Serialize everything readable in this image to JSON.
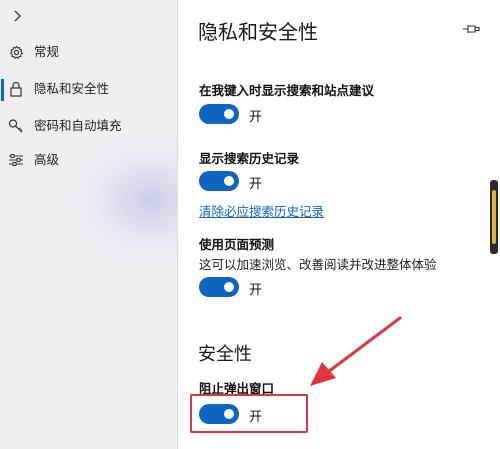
{
  "sidebar": {
    "items": [
      {
        "label": "常规",
        "icon": "gear-icon"
      },
      {
        "label": "隐私和安全性",
        "icon": "lock-icon"
      },
      {
        "label": "密码和自动填充",
        "icon": "key-icon"
      },
      {
        "label": "高级",
        "icon": "sliders-icon"
      }
    ]
  },
  "main": {
    "title": "隐私和安全性",
    "settings": {
      "suggestions": {
        "label": "在我键入时显示搜索和站点建议",
        "state": "开"
      },
      "history": {
        "label": "显示搜索历史记录",
        "state": "开",
        "link": "清除必应搜索历史记录"
      },
      "prediction": {
        "label": "使用页面预测",
        "desc": "这可以加速浏览、改善阅读并改进整体体验",
        "state": "开"
      }
    },
    "security": {
      "title": "安全性",
      "popups": {
        "label": "阻止弹出窗口",
        "state": "开"
      }
    }
  },
  "colors": {
    "accent": "#0f66c2",
    "annotation": "#e0353a"
  }
}
